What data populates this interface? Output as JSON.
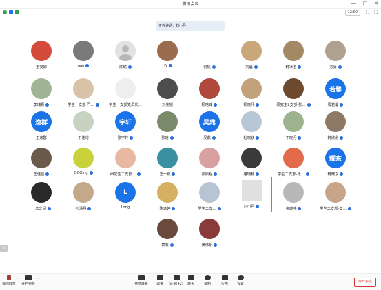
{
  "window": {
    "title": "腾讯会议",
    "controls": [
      "—",
      "□",
      "✕"
    ]
  },
  "infobar": {
    "clock": "12:00",
    "right_icons": [
      "⛶",
      "⛶"
    ]
  },
  "speaking": {
    "text": "正在讲话：刘小丹；"
  },
  "participants": [
    {
      "name": "王安娜",
      "avatar": "photo",
      "color": "#d44b3b",
      "mic": false
    },
    {
      "name": "gao",
      "avatar": "photo",
      "color": "#7a7a7a",
      "mic": true
    },
    {
      "name": "陈瑜",
      "avatar": "default",
      "color": "#e2e2e2",
      "mic": true
    },
    {
      "name": "HY",
      "avatar": "photo",
      "color": "#9a6b4f",
      "mic": true
    },
    {
      "name": "倪帆",
      "avatar": "none",
      "color": "#ffffff",
      "mic": true
    },
    {
      "name": "刘晨",
      "avatar": "photo",
      "color": "#c9a77a",
      "mic": true
    },
    {
      "name": "韩冰玉",
      "avatar": "photo",
      "color": "#a48a64",
      "mic": true
    },
    {
      "name": "方豪",
      "avatar": "photo",
      "color": "#b0a090",
      "mic": true
    },
    {
      "name": "李瑞青",
      "avatar": "photo",
      "color": "#9fb596",
      "mic": true
    },
    {
      "name": "学生一支部 严…",
      "avatar": "photo",
      "color": "#d8c3a8",
      "mic": true
    },
    {
      "name": "学生一支部党员代…",
      "avatar": "photo",
      "color": "#eeeeee",
      "mic": false
    },
    {
      "name": "刘先旭",
      "avatar": "photo",
      "color": "#4d4d4d",
      "mic": false
    },
    {
      "name": "杨晗峰",
      "avatar": "photo",
      "color": "#b0483c",
      "mic": true
    },
    {
      "name": "杨晓凡",
      "avatar": "photo",
      "color": "#c2a27a",
      "mic": true
    },
    {
      "name": "研究生2支部-张…",
      "avatar": "photo",
      "color": "#6d4a2e",
      "mic": true
    },
    {
      "name": "周若馨",
      "avatar": "text",
      "text": "若馨",
      "color": "#1a73e8",
      "mic": true
    },
    {
      "name": "王逸群",
      "avatar": "text",
      "text": "逸群",
      "color": "#1a73e8",
      "mic": false
    },
    {
      "name": "于佳增",
      "avatar": "photo",
      "color": "#c7d3c0",
      "mic": false
    },
    {
      "name": "张宇轩",
      "avatar": "text",
      "text": "宇轩",
      "color": "#1a73e8",
      "mic": true
    },
    {
      "name": "张晗",
      "avatar": "photo",
      "color": "#7a8a6a",
      "mic": true
    },
    {
      "name": "吴鼎",
      "avatar": "text",
      "text": "吴鼎",
      "color": "#1a73e8",
      "mic": true
    },
    {
      "name": "杜晓锐",
      "avatar": "photo",
      "color": "#b7c7d6",
      "mic": true
    },
    {
      "name": "于晓丹",
      "avatar": "photo",
      "color": "#9db38f",
      "mic": true
    },
    {
      "name": "韩欣彤",
      "avatar": "photo",
      "color": "#8e7a64",
      "mic": true
    },
    {
      "name": "王佳佳",
      "avatar": "photo",
      "color": "#6a5a4a",
      "mic": true
    },
    {
      "name": "QQXing",
      "avatar": "photo",
      "color": "#c9d23a",
      "mic": true
    },
    {
      "name": "研究生二支部…",
      "avatar": "photo",
      "color": "#e8b9a0",
      "mic": true
    },
    {
      "name": "王一默",
      "avatar": "photo",
      "color": "#3a8fa0",
      "mic": true
    },
    {
      "name": "梁辰程",
      "avatar": "photo",
      "color": "#d8a0a0",
      "mic": true
    },
    {
      "name": "路珊赫",
      "avatar": "photo",
      "color": "#3a3a3a",
      "mic": true
    },
    {
      "name": "学生二支部-张…",
      "avatar": "photo",
      "color": "#e36a4a",
      "mic": true
    },
    {
      "name": "韩耀东",
      "avatar": "text",
      "text": "耀东",
      "color": "#1a73e8",
      "mic": true
    },
    {
      "name": "一念之间",
      "avatar": "photo",
      "color": "#2a2a2a",
      "mic": true
    },
    {
      "name": "叶清丹",
      "avatar": "photo",
      "color": "#c4a88a",
      "mic": true
    },
    {
      "name": "Long",
      "avatar": "text",
      "text": "L",
      "color": "#1a73e8",
      "mic": false
    },
    {
      "name": "陈逸婷",
      "avatar": "photo",
      "color": "#d4b060",
      "mic": true
    },
    {
      "name": "学生二支…",
      "avatar": "photo",
      "color": "#b6c4d4",
      "mic": true
    },
    {
      "name": "刘小丹",
      "avatar": "photo",
      "color": "#e0e0e0",
      "mic": true,
      "active": true
    },
    {
      "name": "金瑜婷",
      "avatar": "photo",
      "color": "#b8b8b8",
      "mic": true
    },
    {
      "name": "学生二支部-支…",
      "avatar": "photo",
      "color": "#c7a58a",
      "mic": true
    },
    {
      "name": "袁石",
      "avatar": "photo",
      "color": "#6a4a3a",
      "mic": true
    },
    {
      "name": "黄伟钒",
      "avatar": "photo",
      "color": "#8a3a3a",
      "mic": true
    }
  ],
  "toolbar": {
    "mute": "解除静音",
    "video": "开启视频",
    "share": "共享屏幕",
    "invite": "邀请",
    "members": "成员(42)",
    "chat": "聊天",
    "record": "录制",
    "apps": "应用",
    "settings": "设置",
    "leave": "离开会议"
  },
  "side": {
    "label": "≡"
  }
}
